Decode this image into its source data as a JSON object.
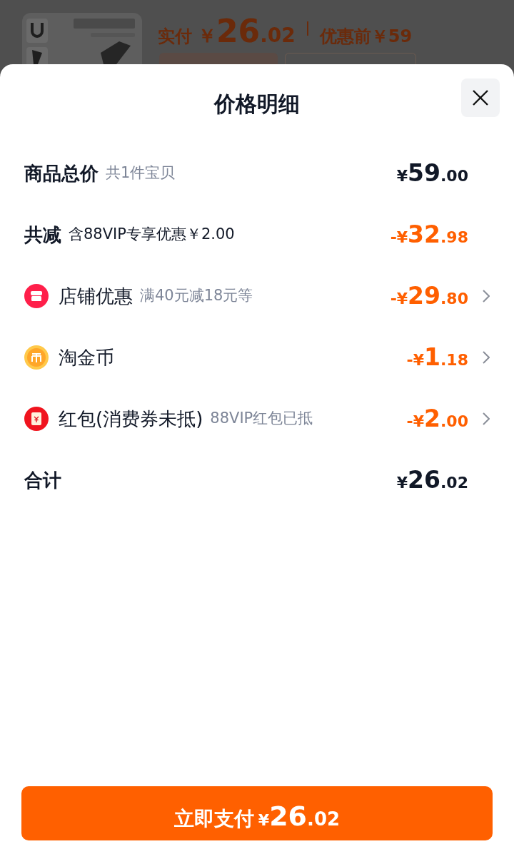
{
  "background_product": {
    "paid_label": "实付",
    "paid_currency": "￥",
    "paid_integer": "26",
    "paid_decimal": ".02",
    "before_label": "优惠前￥59"
  },
  "sheet": {
    "title": "价格明细",
    "rows": [
      {
        "kind": "heading",
        "label": "商品总价",
        "note": "共1件宝贝",
        "note_emphasized": false,
        "amount": {
          "prefix": "¥",
          "integer": "59",
          "decimal": ".00",
          "discount": false
        },
        "chevron": false
      },
      {
        "kind": "heading",
        "label": "共减",
        "note": "含88VIP专享优惠￥2.00",
        "note_emphasized": true,
        "amount": {
          "prefix": "-¥",
          "integer": "32",
          "decimal": ".98",
          "discount": true
        },
        "chevron": false
      },
      {
        "kind": "shop",
        "label": "店铺优惠",
        "note": "满40元减18元等",
        "note_emphasized": false,
        "amount": {
          "prefix": "-¥",
          "integer": "29",
          "decimal": ".80",
          "discount": true
        },
        "chevron": true
      },
      {
        "kind": "coin",
        "label": "淘金币",
        "amount": {
          "prefix": "-¥",
          "integer": "1",
          "decimal": ".18",
          "discount": true
        },
        "chevron": true
      },
      {
        "kind": "envelope",
        "label": "红包(消费券未抵)",
        "note": "88VIP红包已抵",
        "note_emphasized": false,
        "amount": {
          "prefix": "-¥",
          "integer": "2",
          "decimal": ".00",
          "discount": true
        },
        "chevron": true
      },
      {
        "kind": "heading",
        "label": "合计",
        "amount": {
          "prefix": "¥",
          "integer": "26",
          "decimal": ".02",
          "discount": false
        },
        "chevron": false
      }
    ],
    "pay_button": {
      "label": "立即支付",
      "prefix": "¥",
      "integer": "26",
      "decimal": ".02"
    }
  }
}
